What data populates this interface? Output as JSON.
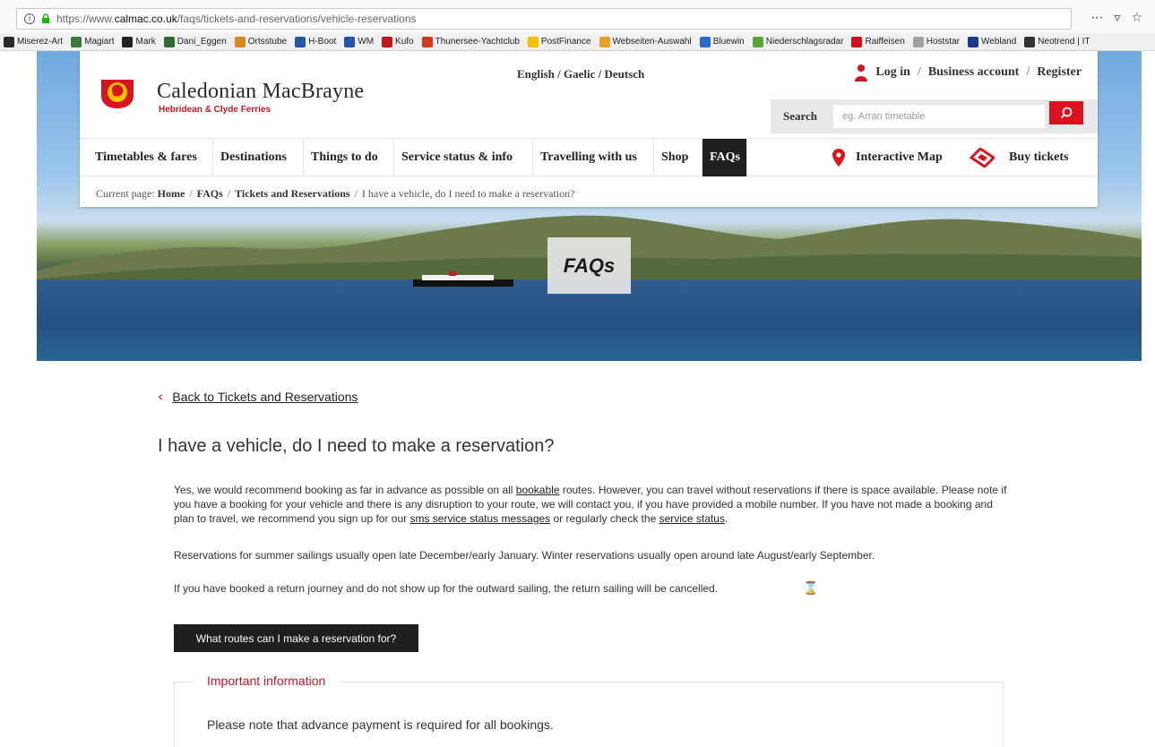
{
  "browser": {
    "url_prefix": "https://www.",
    "url_domain": "calmac.co.uk",
    "url_path": "/faqs/tickets-and-reservations/vehicle-reservations",
    "menu_glyph": "⋯",
    "pocket_glyph": "▿",
    "star_glyph": "☆"
  },
  "bookmarks": [
    {
      "label": "Miserez-Art",
      "color": "#2b2b2b"
    },
    {
      "label": "Magiart",
      "color": "#3a7a3a"
    },
    {
      "label": "Mark",
      "color": "#222222"
    },
    {
      "label": "Dani_Eggen",
      "color": "#2f6b2f"
    },
    {
      "label": "Ortsstube",
      "color": "#d58a1a"
    },
    {
      "label": "H-Boot",
      "color": "#2455a4"
    },
    {
      "label": "WM",
      "color": "#2455a4"
    },
    {
      "label": "Kufo",
      "color": "#c01818"
    },
    {
      "label": "Thunersee-Yachtclub",
      "color": "#d4381a"
    },
    {
      "label": "PostFinance",
      "color": "#f2c200"
    },
    {
      "label": "Webseiten-Auswahl",
      "color": "#e8a020"
    },
    {
      "label": "Bluewin",
      "color": "#2a6ad0"
    },
    {
      "label": "Niederschlagsradar",
      "color": "#5aa53a"
    },
    {
      "label": "Raiffeisen",
      "color": "#d0101a"
    },
    {
      "label": "Hoststar",
      "color": "#a0a0a0"
    },
    {
      "label": "Webland",
      "color": "#1a3a8a"
    },
    {
      "label": "Neotrend | IT",
      "color": "#333333"
    }
  ],
  "header": {
    "brand": "Caledonian MacBrayne",
    "brand_sub": "Hebridean & Clyde Ferries",
    "languages": "English / Gaelic / Deutsch",
    "login": "Log in",
    "business": "Business account",
    "register": "Register",
    "sep": "/",
    "search_label": "Search",
    "search_placeholder": "eg. Arran timetable",
    "accent": "#d9141f"
  },
  "nav": {
    "items": [
      "Timetables & fares",
      "Destinations",
      "Things to do",
      "Service status & info",
      "Travelling with us",
      "Shop",
      "FAQs"
    ],
    "map": "Interactive Map",
    "buy": "Buy tickets"
  },
  "breadcrumb": {
    "prefix": "Current page:",
    "home": "Home",
    "faqs": "FAQs",
    "section": "Tickets and Reservations",
    "current": "I have a vehicle, do I need to make a reservation?",
    "sep": "/"
  },
  "hero": {
    "title": "FAQs"
  },
  "content": {
    "back": "Back to Tickets and Reservations",
    "title": "I have a vehicle, do I need to make a reservation?",
    "p1_a": "Yes, we would recommend booking as far in advance as possible on all ",
    "p1_link1": "bookable",
    "p1_b": " routes. However, you can travel without reservations if there is space available. Please note if you have a booking for your vehicle and there is any disruption to your route, we will contact you, if you have provided a mobile number. If you have not made a booking and plan to travel, we recommend you sign up for our ",
    "p1_link2": "sms service status messages",
    "p1_c": " or regularly check the ",
    "p1_link3": "service status",
    "p1_d": ".",
    "p2": "Reservations for summer sailings usually open late December/early January. Winter reservations usually open around late August/early September.",
    "p3": "If you have booked a return journey and do not show up for the outward sailing, the return sailing will be cancelled.",
    "routes_button": "What routes can I make a reservation for?",
    "info_title": "Important information",
    "info_text": "Please note that advance payment is required for all bookings."
  }
}
